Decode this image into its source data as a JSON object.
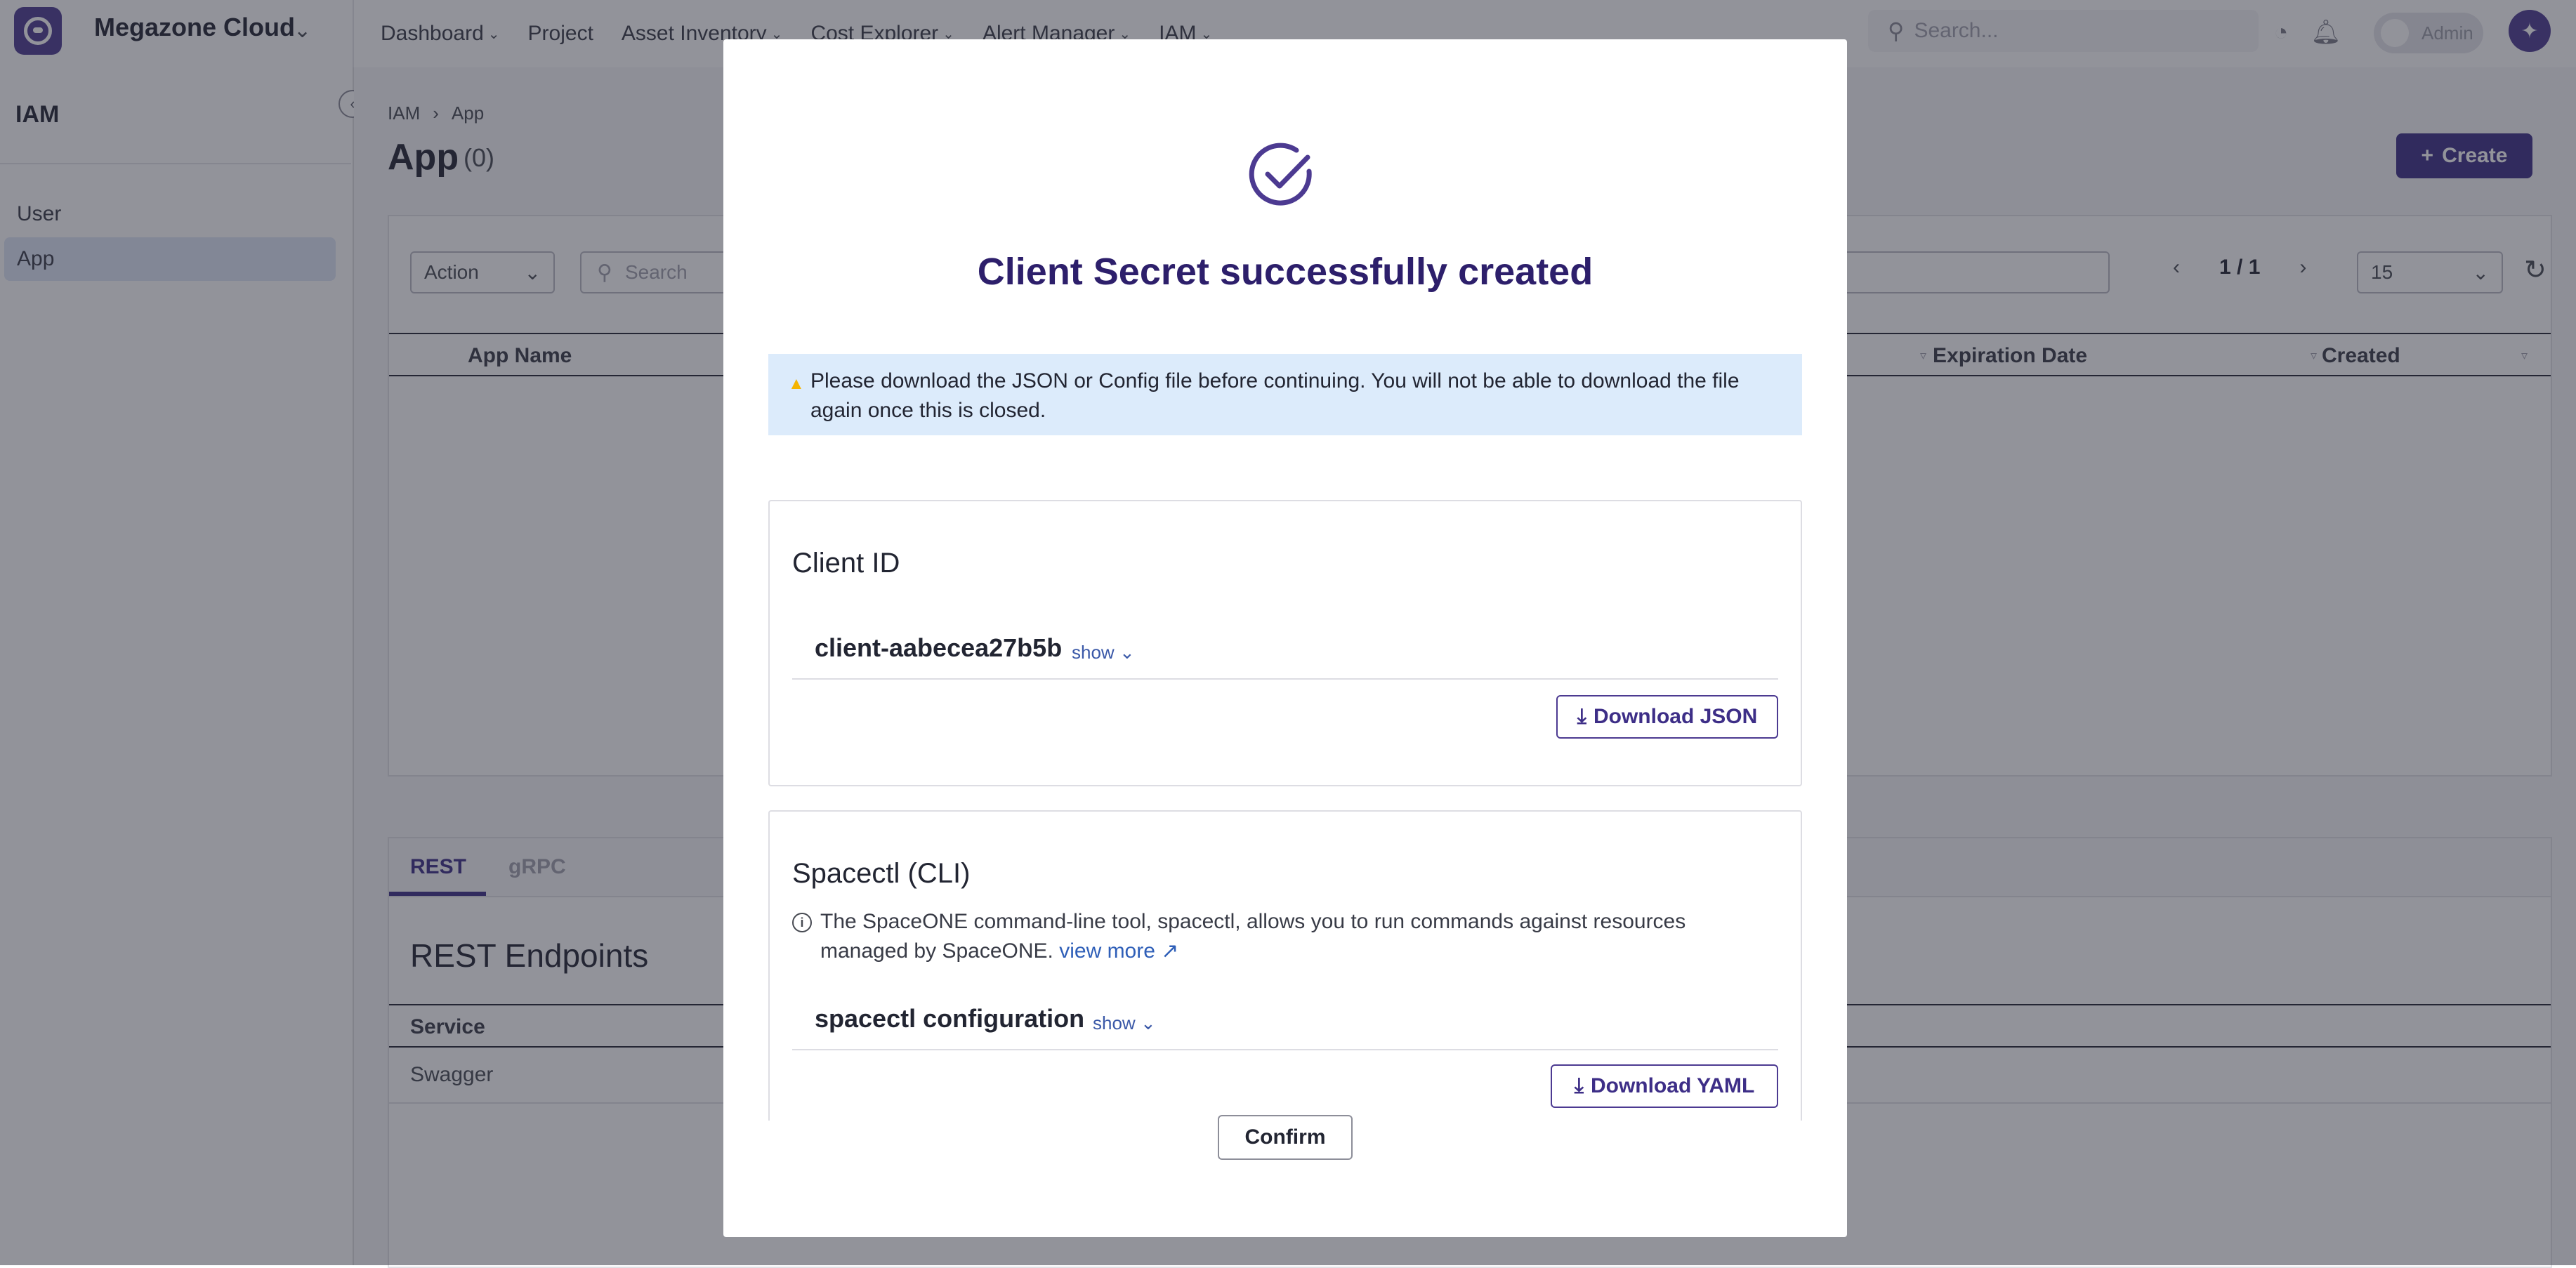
{
  "topbar": {
    "workspace": "Megazone Cloud",
    "nav": [
      {
        "label": "Dashboard",
        "has_menu": true
      },
      {
        "label": "Project",
        "has_menu": false
      },
      {
        "label": "Asset Inventory",
        "has_menu": true
      },
      {
        "label": "Cost Explorer",
        "has_menu": true
      },
      {
        "label": "Alert Manager",
        "has_menu": true
      },
      {
        "label": "IAM",
        "has_menu": true
      }
    ],
    "search_placeholder": "Search...",
    "admin_toggle_label": "Admin"
  },
  "sidebar": {
    "title": "IAM",
    "items": [
      {
        "label": "User",
        "active": false
      },
      {
        "label": "App",
        "active": true
      }
    ]
  },
  "main": {
    "breadcrumb": [
      "IAM",
      "App"
    ],
    "title": "App",
    "count": "(0)",
    "create_label": "Create",
    "toolbar": {
      "action_label": "Action",
      "search_placeholder": "Search",
      "page_indicator": "1 / 1",
      "page_size": "15"
    },
    "columns": [
      "App Name",
      "Expiration Date",
      "Created"
    ],
    "tabs": [
      {
        "label": "REST",
        "active": true
      },
      {
        "label": "gRPC",
        "active": false
      }
    ],
    "endpoints_title": "REST Endpoints",
    "endpoints_column": "Service",
    "endpoints_rows": [
      "Swagger"
    ]
  },
  "modal": {
    "title": "Client Secret successfully created",
    "alert_text": "Please download the JSON or Config file before continuing. You will not be able to download the file again once this is closed.",
    "client_section": {
      "title": "Client ID",
      "key": "client-aabecea27b5b",
      "show_label": "show",
      "download_label": "Download JSON"
    },
    "cli_section": {
      "title": "Spacectl (CLI)",
      "info_text": "The SpaceONE command-line tool, spacectl, allows you to run commands against resources managed by SpaceONE.",
      "info_link": "view more",
      "key": "spacectl configuration",
      "show_label": "show",
      "download_label": "Download YAML"
    },
    "confirm_label": "Confirm"
  },
  "colors": {
    "brand": "#3d2e87",
    "modal_title": "#2d1f6b",
    "alert_bg": "#dcebfb",
    "link": "#2f5fb8",
    "overlay": "rgba(37,40,54,0.50)"
  },
  "icons": {
    "success": "check-circle-icon",
    "warning": "warning-triangle-icon",
    "info": "info-circle-icon",
    "download": "download-icon",
    "external": "external-link-icon"
  }
}
